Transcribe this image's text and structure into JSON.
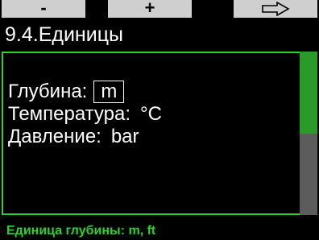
{
  "softkeys": {
    "left_label": "-",
    "middle_label": "+",
    "right_icon": "arrow-right-icon"
  },
  "title": "9.4.Единицы",
  "settings": [
    {
      "label": "Глубина:",
      "value": "m"
    },
    {
      "label": "Температура:",
      "value": "°C"
    },
    {
      "label": "Давление:",
      "value": "bar"
    }
  ],
  "hint": "Единица глубины: m, ft",
  "colors": {
    "accent_green": "#2bd22b",
    "softkey_bg": "#cfcfcf",
    "scrollbar_track": "#5c5c5c",
    "scrollbar_thumb": "#2a9a2a"
  },
  "scroll_position": 0.5
}
